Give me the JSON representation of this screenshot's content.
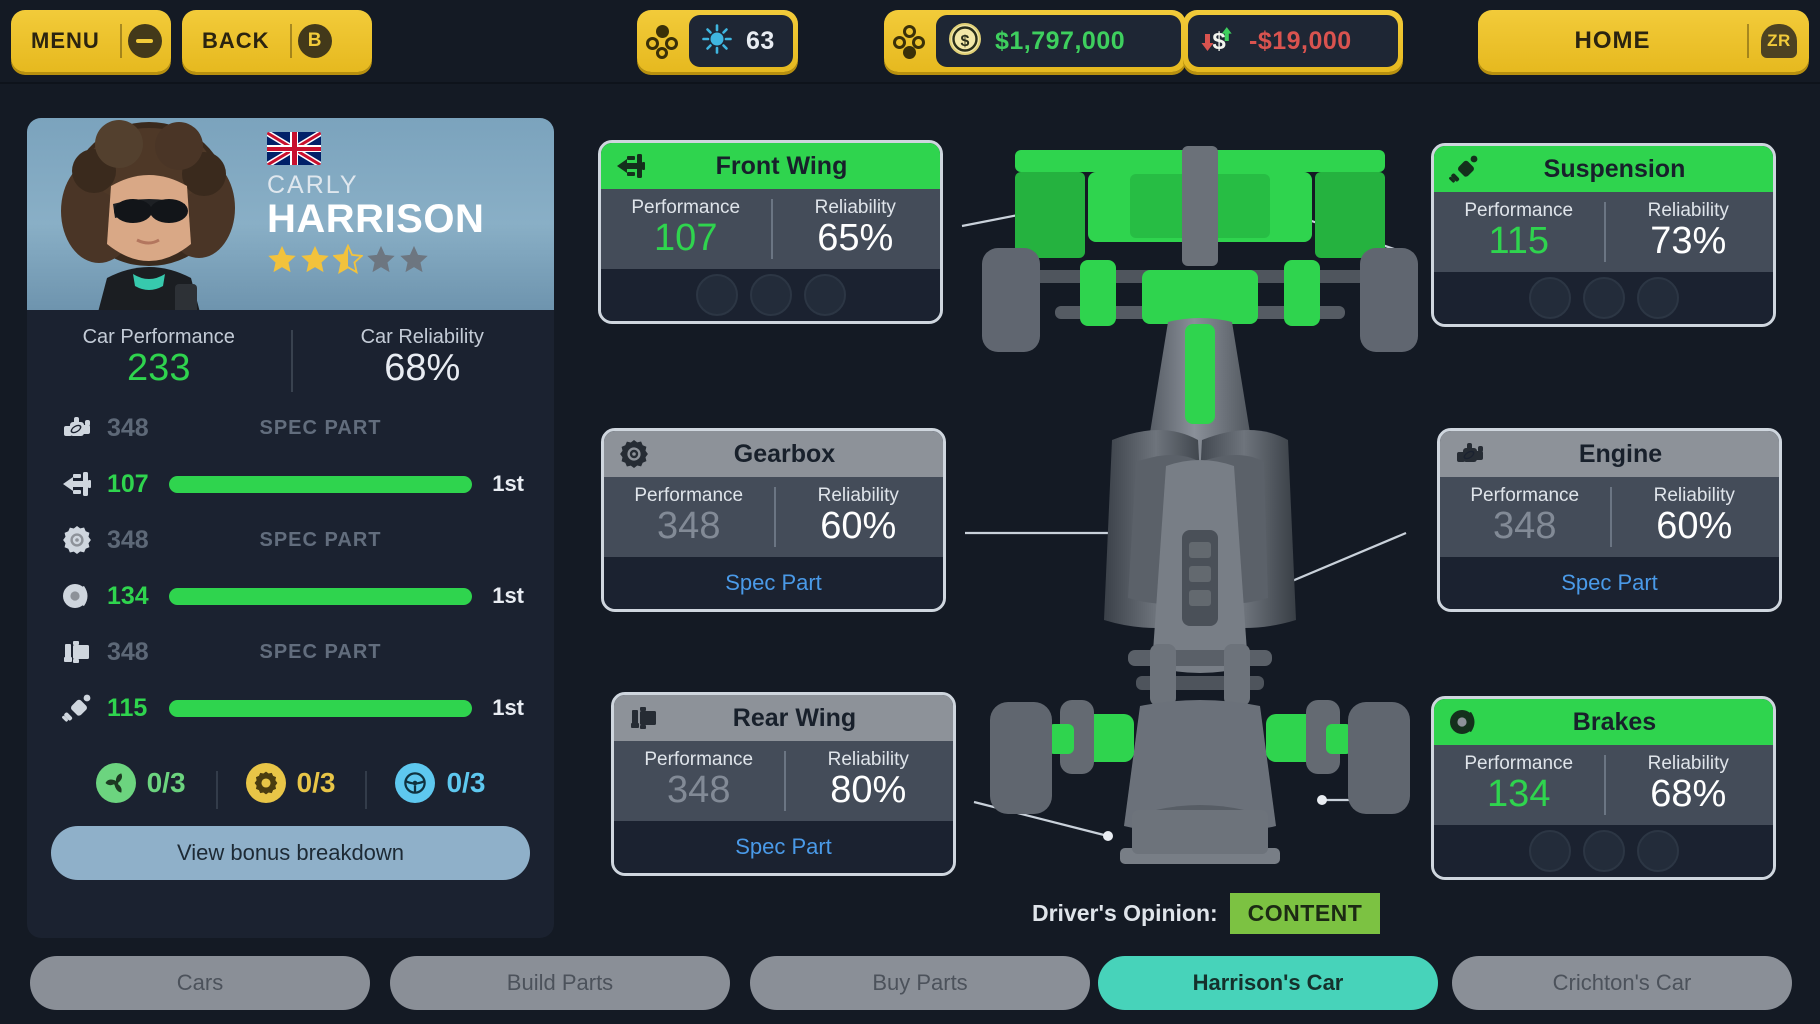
{
  "topbar": {
    "menu_label": "MENU",
    "menu_badge": "minus-icon",
    "back_label": "BACK",
    "back_badge": "B",
    "home_label": "HOME",
    "home_badge": "ZR",
    "resources": [
      {
        "name": "parts-points",
        "icon": "gear-burst-icon",
        "value": "63",
        "color": "#e8ecf2"
      },
      {
        "name": "balance",
        "icon": "coin-icon",
        "value": "$1,797,000",
        "color": "#3ecf5e"
      },
      {
        "name": "income-delta",
        "icon": "money-trend-icon",
        "value": "-$19,000",
        "color": "#d9534f"
      }
    ]
  },
  "driver": {
    "first_name": "CARLY",
    "last_name": "HARRISON",
    "nationality": "united-kingdom",
    "rating": 2.5,
    "rating_max": 5
  },
  "car_totals": {
    "performance_label": "Car Performance",
    "performance_value": "233",
    "reliability_label": "Car Reliability",
    "reliability_value": "68%"
  },
  "part_rows": [
    {
      "icon": "engine-icon",
      "value": "348",
      "state": "spec",
      "spec_label": "SPEC PART",
      "position": ""
    },
    {
      "icon": "front-wing-icon",
      "value": "107",
      "state": "fitted",
      "spec_label": "",
      "position": "1st"
    },
    {
      "icon": "gearbox-icon",
      "value": "348",
      "state": "spec",
      "spec_label": "SPEC PART",
      "position": ""
    },
    {
      "icon": "brakes-icon",
      "value": "134",
      "state": "fitted",
      "spec_label": "",
      "position": "1st"
    },
    {
      "icon": "rear-wing-icon",
      "value": "348",
      "state": "spec",
      "spec_label": "SPEC PART",
      "position": ""
    },
    {
      "icon": "suspension-icon",
      "value": "115",
      "state": "fitted",
      "spec_label": "",
      "position": "1st"
    }
  ],
  "bonuses": [
    {
      "icon": "aero-fan-icon",
      "value": "0/3",
      "color": "#6cd47f"
    },
    {
      "icon": "gear-icon",
      "value": "0/3",
      "color": "#e8c547"
    },
    {
      "icon": "steering-wheel-icon",
      "value": "0/3",
      "color": "#5ec8ef"
    }
  ],
  "bonus_button_label": "View bonus breakdown",
  "part_cards": [
    {
      "id": "front-wing",
      "title": "Front Wing",
      "icon": "front-wing-icon",
      "header_style": "green",
      "performance_label": "Performance",
      "performance_value": "107",
      "performance_style": "green",
      "reliability_label": "Reliability",
      "reliability_value": "65%",
      "footer_type": "slots",
      "slots": 3,
      "spec_label": ""
    },
    {
      "id": "gearbox",
      "title": "Gearbox",
      "icon": "gearbox-icon",
      "header_style": "grey",
      "performance_label": "Performance",
      "performance_value": "348",
      "performance_style": "grey",
      "reliability_label": "Reliability",
      "reliability_value": "60%",
      "footer_type": "spec",
      "slots": 0,
      "spec_label": "Spec Part"
    },
    {
      "id": "rear-wing",
      "title": "Rear Wing",
      "icon": "rear-wing-icon",
      "header_style": "grey",
      "performance_label": "Performance",
      "performance_value": "348",
      "performance_style": "grey",
      "reliability_label": "Reliability",
      "reliability_value": "80%",
      "footer_type": "spec",
      "slots": 0,
      "spec_label": "Spec Part"
    },
    {
      "id": "suspension",
      "title": "Suspension",
      "icon": "suspension-icon",
      "header_style": "green",
      "performance_label": "Performance",
      "performance_value": "115",
      "performance_style": "green",
      "reliability_label": "Reliability",
      "reliability_value": "73%",
      "footer_type": "slots",
      "slots": 3,
      "spec_label": ""
    },
    {
      "id": "engine",
      "title": "Engine",
      "icon": "engine-icon",
      "header_style": "grey",
      "performance_label": "Performance",
      "performance_value": "348",
      "performance_style": "grey",
      "reliability_label": "Reliability",
      "reliability_value": "60%",
      "footer_type": "spec",
      "slots": 0,
      "spec_label": "Spec Part"
    },
    {
      "id": "brakes",
      "title": "Brakes",
      "icon": "brakes-icon",
      "header_style": "green",
      "performance_label": "Performance",
      "performance_value": "134",
      "performance_style": "green",
      "reliability_label": "Reliability",
      "reliability_value": "68%",
      "footer_type": "slots",
      "slots": 3,
      "spec_label": ""
    }
  ],
  "opinion": {
    "label": "Driver's Opinion:",
    "value": "CONTENT",
    "color": "#7cc242"
  },
  "tabs": [
    {
      "label": "Cars",
      "active": false
    },
    {
      "label": "Build Parts",
      "active": false
    },
    {
      "label": "Buy Parts",
      "active": false
    },
    {
      "label": "Harrison's Car",
      "active": true
    },
    {
      "label": "Crichton's Car",
      "active": false
    }
  ]
}
